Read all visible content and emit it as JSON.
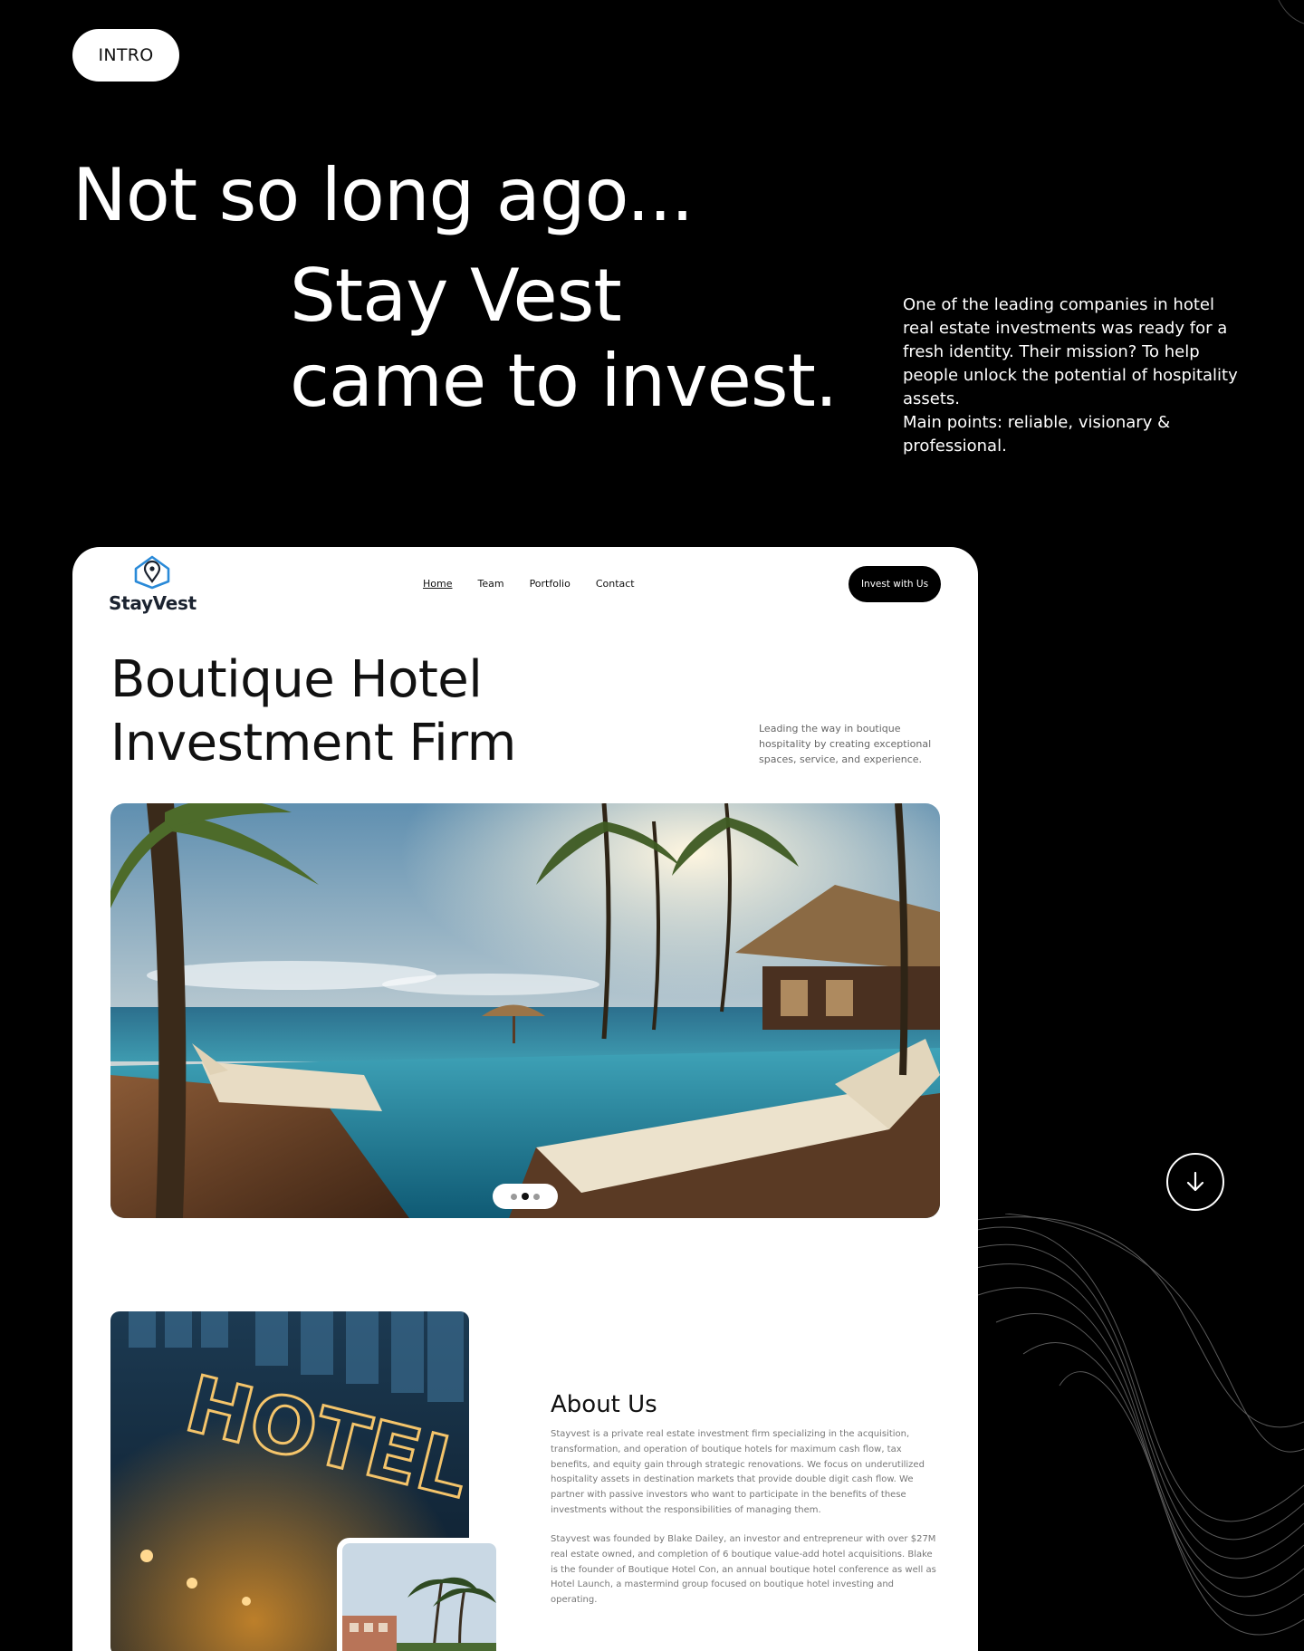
{
  "intro": {
    "label": "INTRO"
  },
  "headline": {
    "line1": "Not so long ago...",
    "line2": "Stay Vest",
    "line3": "came to invest."
  },
  "mission": {
    "text": "One of the leading companies in hotel real estate investments was ready for a fresh identity. Their mission? To help people unlock the potential of hospitality assets.",
    "points": "Main points: reliable, visionary & professional."
  },
  "site": {
    "logo_text": "StayVest",
    "nav": {
      "home": "Home",
      "team": "Team",
      "portfolio": "Portfolio",
      "contact": "Contact"
    },
    "cta_label": "Invest with Us",
    "hero_title_line1": "Boutique Hotel",
    "hero_title_line2": "Investment Firm",
    "hero_subtitle": "Leading the way in boutique hospitality by creating exceptional spaces, service, and experience.",
    "hotel_sign": "HOTEL",
    "about": {
      "title": "About Us",
      "p1": "Stayvest is a private real estate investment firm specializing in the acquisition, transformation, and operation of boutique hotels for maximum cash flow, tax benefits, and equity gain through strategic renovations. We focus on underutilized hospitality assets in destination markets that provide double digit cash flow. We partner with passive investors who want to participate in the benefits of these investments without the responsibilities of managing them.",
      "p2": "Stayvest was founded by Blake Dailey, an investor and entrepreneur with over $27M real estate owned, and completion of 6 boutique value-add hotel acquisitions. Blake is the founder of Boutique Hotel Con, an annual boutique hotel conference as well as Hotel Launch, a mastermind group focused on boutique hotel investing and operating."
    }
  },
  "colors": {
    "background": "#000000",
    "logo_blue": "#2a8ad8",
    "card": "#ffffff"
  },
  "icons": [
    "arrow-down-icon",
    "house-pin-logo-icon"
  ]
}
